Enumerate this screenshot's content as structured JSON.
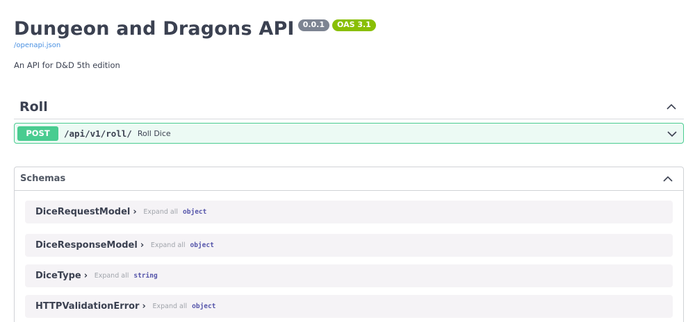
{
  "info": {
    "title": "Dungeon and Dragons API",
    "version_badge": "0.0.1",
    "oas_badge": "OAS 3.1",
    "spec_link": "/openapi.json",
    "description": "An API for D&D 5th edition"
  },
  "tag": {
    "name": "Roll",
    "operations": [
      {
        "method": "POST",
        "path": "/api/v1/roll/",
        "summary": "Roll Dice"
      }
    ]
  },
  "schemas": {
    "title": "Schemas",
    "models": [
      {
        "name": "DiceRequestModel",
        "expand_label": "Expand all",
        "type": "object"
      },
      {
        "name": "DiceResponseModel",
        "expand_label": "Expand all",
        "type": "object"
      },
      {
        "name": "DiceType",
        "expand_label": "Expand all",
        "type": "string"
      },
      {
        "name": "HTTPValidationError",
        "expand_label": "Expand all",
        "type": "object"
      }
    ]
  },
  "colors": {
    "post": "#49cc90",
    "version_badge": "#7d8492",
    "oas_badge": "#89bf04",
    "link": "#4990e2"
  }
}
